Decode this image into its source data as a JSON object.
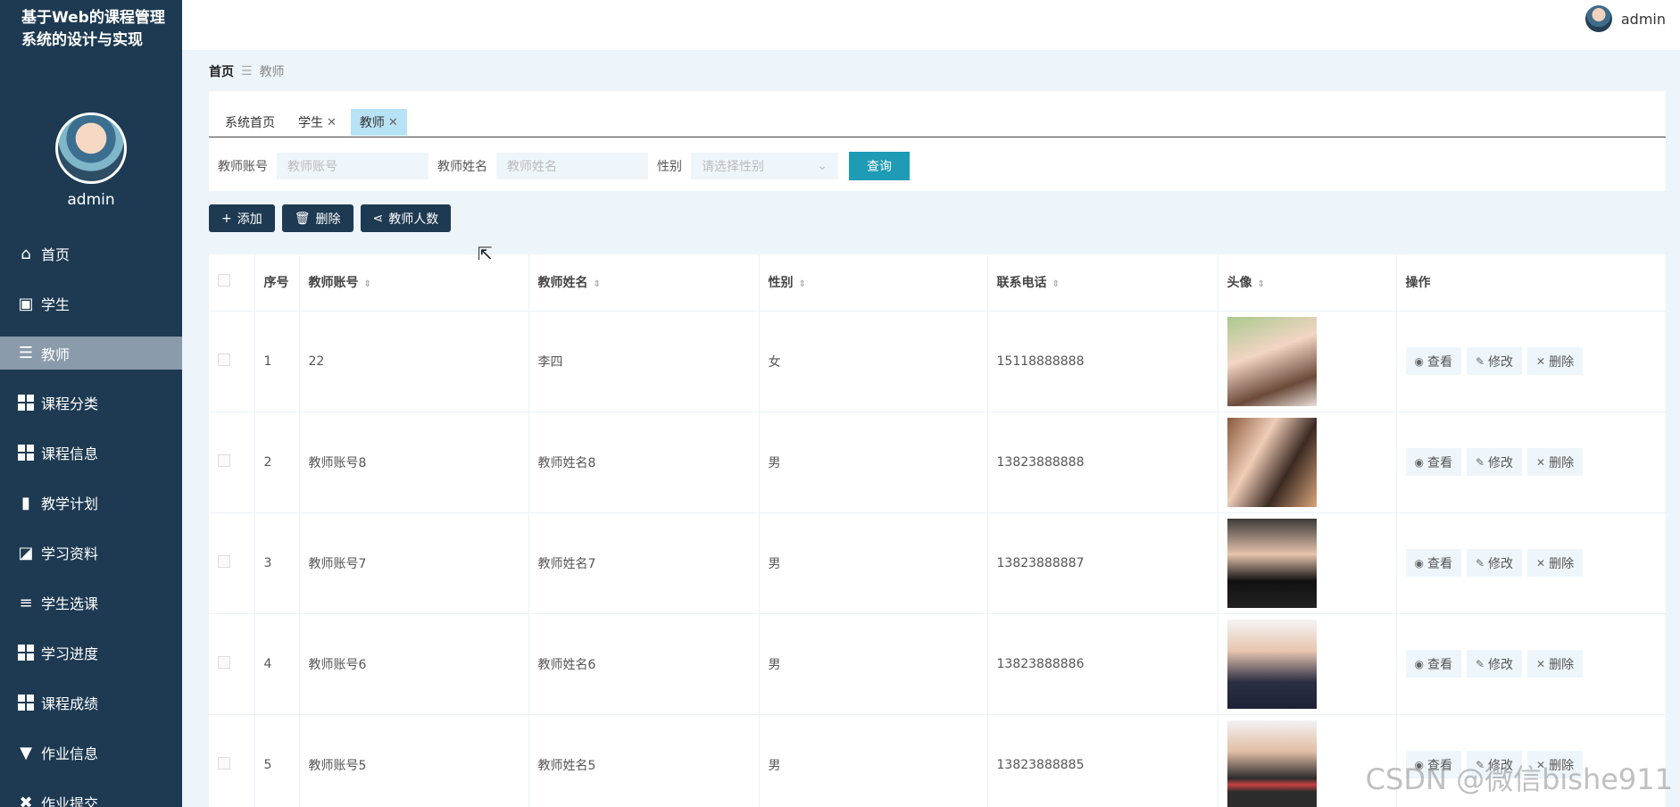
{
  "sidebar": {
    "title": "基于Web的课程管理系统的设计与实现",
    "username": "admin",
    "items": [
      {
        "label": "首页",
        "icon": "home-icon"
      },
      {
        "label": "学生",
        "icon": "clipboard-icon"
      },
      {
        "label": "教师",
        "icon": "sliders-icon"
      },
      {
        "label": "课程分类",
        "icon": "grid-icon"
      },
      {
        "label": "课程信息",
        "icon": "grid-icon"
      },
      {
        "label": "教学计划",
        "icon": "bar-chart-icon"
      },
      {
        "label": "学习资料",
        "icon": "line-chart-icon"
      },
      {
        "label": "学生选课",
        "icon": "list-icon"
      },
      {
        "label": "学习进度",
        "icon": "grid-icon"
      },
      {
        "label": "课程成绩",
        "icon": "grid-icon"
      },
      {
        "label": "作业信息",
        "icon": "pin-icon"
      },
      {
        "label": "作业提交",
        "icon": "tools-icon"
      }
    ],
    "active_index": 2
  },
  "topbar": {
    "username": "admin"
  },
  "breadcrumb": {
    "home": "首页",
    "separator": "☰",
    "current": "教师"
  },
  "tabs": [
    {
      "label": "系统首页",
      "closable": false
    },
    {
      "label": "学生",
      "closable": true
    },
    {
      "label": "教师",
      "closable": true,
      "active": true
    }
  ],
  "search": {
    "account_label": "教师账号",
    "account_placeholder": "教师账号",
    "name_label": "教师姓名",
    "name_placeholder": "教师姓名",
    "gender_label": "性别",
    "gender_placeholder": "请选择性别",
    "query_label": "查询"
  },
  "actions": {
    "add": "添加",
    "delete": "删除",
    "count": "教师人数"
  },
  "table": {
    "headers": {
      "index": "序号",
      "account": "教师账号",
      "name": "教师姓名",
      "gender": "性别",
      "phone": "联系电话",
      "avatar": "头像",
      "ops": "操作"
    },
    "ops": {
      "view": "查看",
      "edit": "修改",
      "delete": "删除"
    },
    "rows": [
      {
        "index": "1",
        "account": "22",
        "name": "李四",
        "gender": "女",
        "phone": "15118888888"
      },
      {
        "index": "2",
        "account": "教师账号8",
        "name": "教师姓名8",
        "gender": "男",
        "phone": "13823888888"
      },
      {
        "index": "3",
        "account": "教师账号7",
        "name": "教师姓名7",
        "gender": "男",
        "phone": "13823888887"
      },
      {
        "index": "4",
        "account": "教师账号6",
        "name": "教师姓名6",
        "gender": "男",
        "phone": "13823888886"
      },
      {
        "index": "5",
        "account": "教师账号5",
        "name": "教师姓名5",
        "gender": "男",
        "phone": "13823888885"
      }
    ]
  },
  "watermark": "CSDN @微信bishe911",
  "colors": {
    "sidebar": "#1e3a52",
    "accent": "#1e9bb5",
    "active_tab": "#b8e2f5"
  }
}
